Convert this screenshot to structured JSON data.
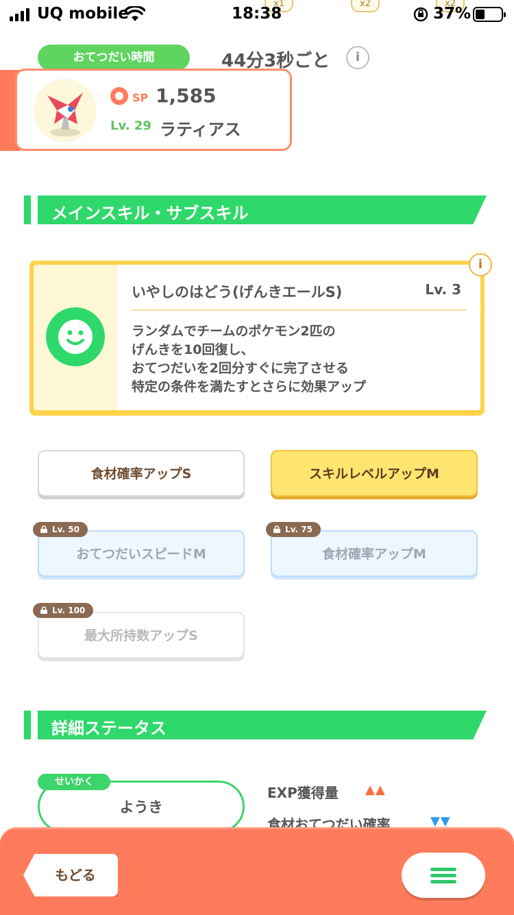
{
  "status_bar": {
    "carrier": "UQ mobile",
    "time": "18:38",
    "battery_percent": "37%",
    "behind_badges": [
      "x1",
      "x2",
      "x2"
    ]
  },
  "helper": {
    "label": "おてつだい時間",
    "value": "44分3秒ごと",
    "info": "i"
  },
  "pokemon": {
    "sp_label": "SP",
    "sp_value": "1,585",
    "level": "Lv. 29",
    "name": "ラティアス"
  },
  "sections": {
    "skills_title": "メインスキル・サブスキル",
    "details_title": "詳細ステータス"
  },
  "main_skill": {
    "name": "いやしのはどう(げんきエールS)",
    "level": "Lv. 3",
    "description": [
      "ランダムでチームのポケモン2匹の",
      "げんきを10回復し、",
      "おてつだいを2回分すぐに完了させる",
      "特定の条件を満たすとさらに効果アップ"
    ],
    "info": "i"
  },
  "sub_skills": [
    {
      "label": "食材確率アップS",
      "lock": ""
    },
    {
      "label": "スキルレベルアップM",
      "lock": ""
    },
    {
      "label": "おてつだいスピードM",
      "lock": "Lv. 50"
    },
    {
      "label": "食材確率アップM",
      "lock": "Lv. 75"
    },
    {
      "label": "最大所持数アップS",
      "lock": "Lv. 100"
    }
  ],
  "details": {
    "nature_tag": "せいかく",
    "nature_value": "ようき",
    "stats": [
      {
        "label": "EXP獲得量",
        "arrows": "▲▲",
        "color": "#ff6a3a"
      },
      {
        "label": "食材おてつだい確率",
        "arrows": "▼▼",
        "color": "#2f9be8"
      }
    ]
  },
  "bottom": {
    "back_label": "もどる"
  },
  "colors": {
    "accent_green": "#2fd86a",
    "accent_orange": "#ff7b5b",
    "skill_gold": "#ffd34a"
  }
}
